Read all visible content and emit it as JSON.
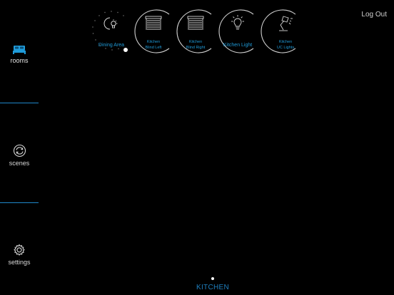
{
  "sidebar": {
    "items": [
      {
        "id": "rooms",
        "label": "rooms",
        "icon": "bed-icon",
        "active": true
      },
      {
        "id": "scenes",
        "label": "scenes",
        "icon": "scenes-icon",
        "active": false
      },
      {
        "id": "settings",
        "label": "settings",
        "icon": "gear-icon",
        "active": false
      }
    ]
  },
  "header": {
    "logout_label": "Log Out"
  },
  "devices": [
    {
      "label": "Dining Area",
      "icon": "moon-bulb-icon",
      "type": "dimmer",
      "level": 0.55
    },
    {
      "label_line1": "Kitchen",
      "label_line2": "Blind Left",
      "icon": "blind-icon"
    },
    {
      "label_line1": "Kitchen",
      "label_line2": "Blind Right",
      "icon": "blind-icon"
    },
    {
      "label": "Kitchen Light",
      "icon": "bulb-icon"
    },
    {
      "label_line1": "Kitchen",
      "label_line2": "UC Lights",
      "icon": "desk-lamp-icon"
    }
  ],
  "room": {
    "name": "KITCHEN"
  },
  "colors": {
    "accent": "#1f9bd9",
    "background": "#000000",
    "text": "#d8d8d8"
  }
}
